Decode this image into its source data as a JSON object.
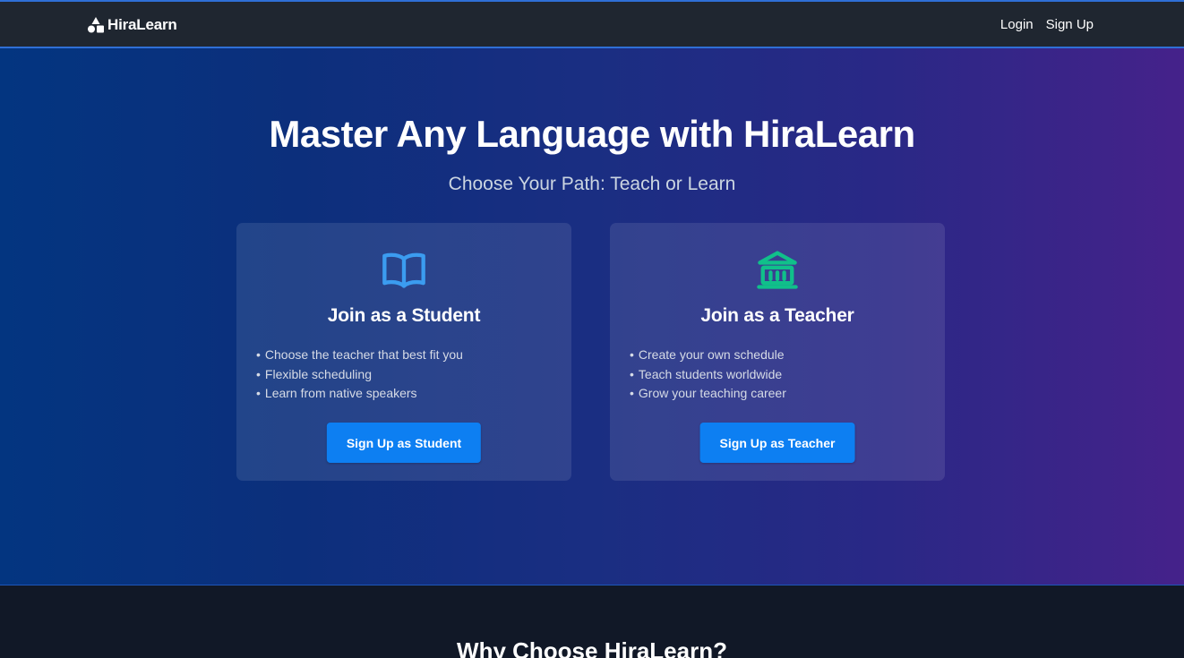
{
  "navbar": {
    "brand": "HiraLearn",
    "logo_icon": "shapes-logo-icon",
    "links": [
      "Login",
      "Sign Up"
    ]
  },
  "hero": {
    "title": "Master Any Language with HiraLearn",
    "subtitle": "Choose Your Path: Teach or Learn"
  },
  "cards": [
    {
      "icon": "open-book-icon",
      "icon_color": "#3b9cf0",
      "title": "Join as a Student",
      "features": [
        "Choose the teacher that best fit you",
        "Flexible scheduling",
        "Learn from native speakers"
      ],
      "button": "Sign Up as Student"
    },
    {
      "icon": "bank-building-icon",
      "icon_color": "#10c08a",
      "title": "Join as a Teacher",
      "features": [
        "Create your own schedule",
        "Teach students worldwide",
        "Grow your teaching career"
      ],
      "button": "Sign Up as Teacher"
    }
  ],
  "why_section": {
    "title": "Why Choose HiraLearn?"
  },
  "colors": {
    "nav_bg": "#1f2630",
    "nav_border": "#2f6fd6",
    "hero_gradient_start": "#033580",
    "hero_gradient_end": "#45228a",
    "button_bg": "#0d7ff2",
    "page_bg": "#111827"
  }
}
